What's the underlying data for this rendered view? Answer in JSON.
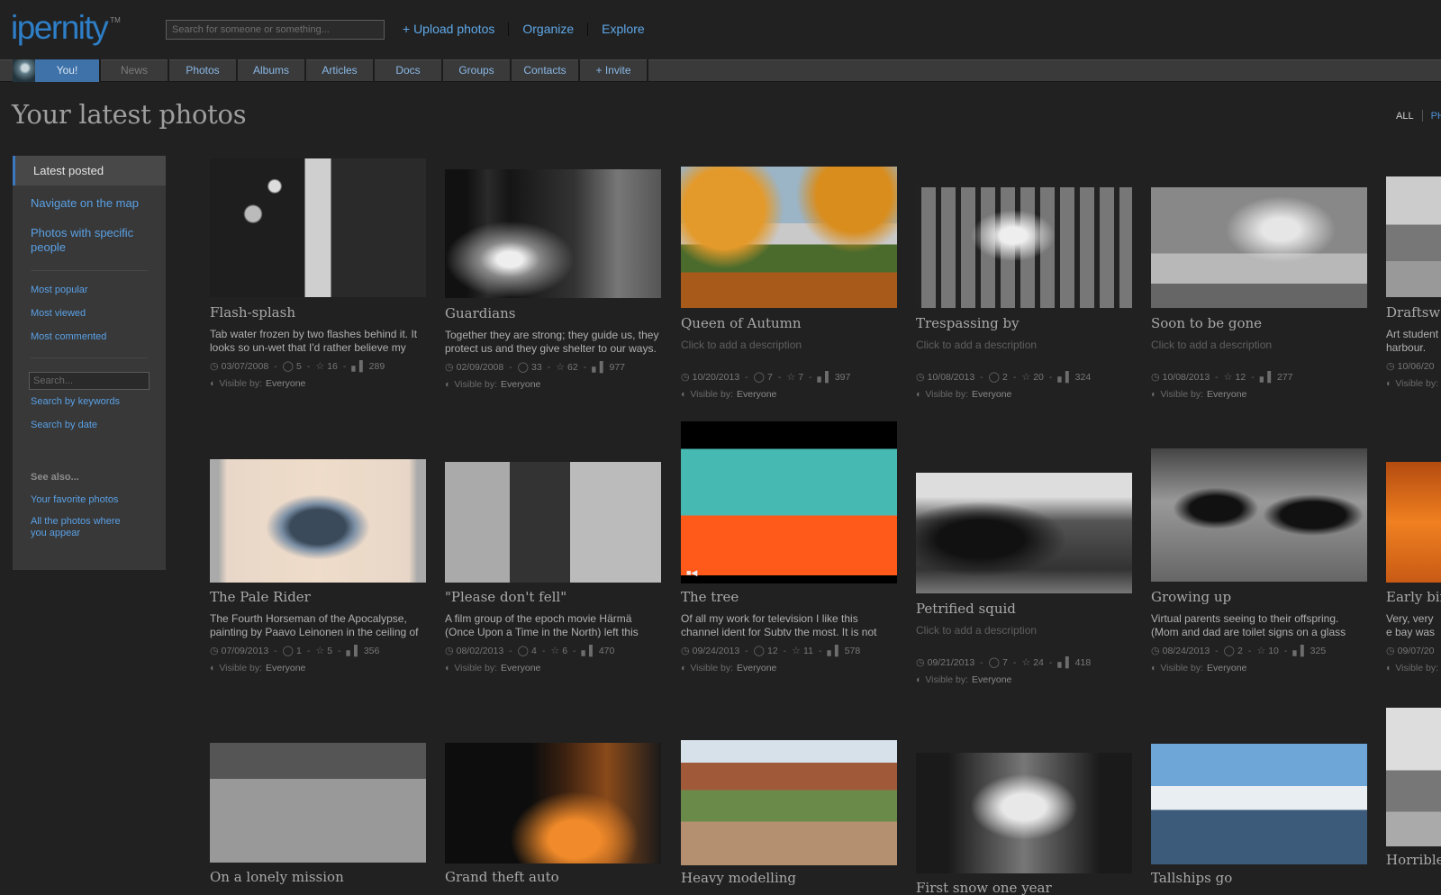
{
  "header": {
    "logo": "ipernity",
    "tm": "TM",
    "search_placeholder": "Search for someone or something...",
    "links": [
      "+ Upload photos",
      "Organize",
      "Explore"
    ]
  },
  "tabs": [
    {
      "label": "You!",
      "state": "active"
    },
    {
      "label": "News",
      "state": "dim"
    },
    {
      "label": "Photos",
      "state": "normal"
    },
    {
      "label": "Albums",
      "state": "normal"
    },
    {
      "label": "Articles",
      "state": "normal"
    },
    {
      "label": "Docs",
      "state": "normal"
    },
    {
      "label": "Groups",
      "state": "normal"
    },
    {
      "label": "Contacts",
      "state": "normal"
    },
    {
      "label": "+ Invite",
      "state": "normal"
    }
  ],
  "page_title": "Your latest photos",
  "filters": {
    "all": "ALL",
    "next": "PH"
  },
  "sidebar": {
    "active": "Latest posted",
    "nav": [
      "Navigate on the map",
      "Photos with specific people"
    ],
    "sort": [
      "Most popular",
      "Most viewed",
      "Most commented"
    ],
    "search_placeholder": "Search...",
    "search_links": [
      "Search by keywords",
      "Search by date"
    ],
    "see_also_title": "See also...",
    "see_also": [
      "Your favorite photos",
      "All the photos where you appear"
    ]
  },
  "visible_label": "Visible by:",
  "visible_value": "Everyone",
  "photos": [
    {
      "title": "Flash-splash",
      "desc": "Tab water frozen by two flashes behind it. It looks so un-wet that I'd rather believe my",
      "date": "03/07/2008",
      "comments": "5",
      "favs": "16",
      "views": "289",
      "art": "splash"
    },
    {
      "title": "Guardians",
      "desc": "Together they are strong; they guide us, they protect us and they give shelter to our ways.",
      "date": "02/09/2008",
      "comments": "33",
      "favs": "62",
      "views": "977",
      "art": "guardians"
    },
    {
      "title": "Queen of Autumn",
      "desc": "Click to add a description",
      "date": "10/20/2013",
      "comments": "7",
      "favs": "7",
      "views": "397",
      "art": "autumn"
    },
    {
      "title": "Trespassing by",
      "desc": "Click to add a description",
      "date": "10/08/2013",
      "comments": "2",
      "favs": "20",
      "views": "324",
      "art": "alley"
    },
    {
      "title": "Soon to be gone",
      "desc": "Click to add a description",
      "date": "10/08/2013",
      "comments": "",
      "favs": "12",
      "views": "277",
      "art": "alley2"
    },
    {
      "title": "Draftswo",
      "desc": "Art student harbour. Se",
      "date": "10/06/20",
      "comments": "",
      "favs": "",
      "views": "",
      "art": "harbour"
    },
    {
      "title": "The Pale Rider",
      "desc": "The Fourth Horseman of the Apocalypse, painting by Paavo Leinonen in the ceiling of",
      "date": "07/09/2013",
      "comments": "1",
      "favs": "5",
      "views": "356",
      "art": "rider"
    },
    {
      "title": "\"Please don't fell\"",
      "desc": "A film group of the epoch movie Härmä (Once Upon a Time in the North) left this",
      "date": "08/02/2013",
      "comments": "4",
      "favs": "6",
      "views": "470",
      "art": "tree-sign"
    },
    {
      "title": "The tree",
      "desc": "Of all my work for television I like this channel ident for Subtv the most. It is not",
      "date": "09/24/2013",
      "comments": "12",
      "favs": "11",
      "views": "578",
      "art": "video"
    },
    {
      "title": "Petrified squid",
      "desc": "Click to add a description",
      "date": "09/21/2013",
      "comments": "7",
      "favs": "24",
      "views": "418",
      "art": "squid"
    },
    {
      "title": "Growing up",
      "desc": "Virtual parents seeing to their offspring. (Mom and dad are toilet signs on a glass wall",
      "date": "08/24/2013",
      "comments": "2",
      "favs": "10",
      "views": "325",
      "art": "growing"
    },
    {
      "title": "Early bir",
      "desc": "Very, very e bay was all",
      "date": "09/07/20",
      "comments": "",
      "favs": "",
      "views": "",
      "art": "sunset"
    },
    {
      "title": "On a lonely mission",
      "desc": "",
      "date": "",
      "comments": "",
      "favs": "",
      "views": "",
      "art": "street"
    },
    {
      "title": "Grand theft auto",
      "desc": "",
      "date": "",
      "comments": "",
      "favs": "",
      "views": "",
      "art": "night"
    },
    {
      "title": "Heavy modelling",
      "desc": "",
      "date": "",
      "comments": "",
      "favs": "",
      "views": "",
      "art": "crowd"
    },
    {
      "title": "First snow one year",
      "desc": "",
      "date": "",
      "comments": "",
      "favs": "",
      "views": "",
      "art": "snow"
    },
    {
      "title": "Tallships go",
      "desc": "",
      "date": "",
      "comments": "",
      "favs": "",
      "views": "",
      "art": "ships"
    },
    {
      "title": "Horrible horribly l",
      "desc": "",
      "date": "",
      "comments": "",
      "favs": "",
      "views": "",
      "art": "bw-sea"
    }
  ]
}
